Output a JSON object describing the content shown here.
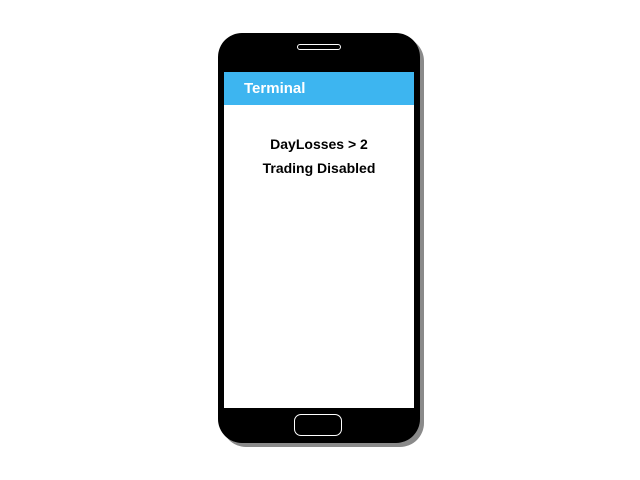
{
  "app": {
    "title": "Terminal"
  },
  "message": {
    "line1": "DayLosses > 2",
    "line2": "Trading Disabled"
  },
  "colors": {
    "title_bar": "#3db5f0",
    "phone_body": "#000000",
    "screen": "#ffffff"
  }
}
